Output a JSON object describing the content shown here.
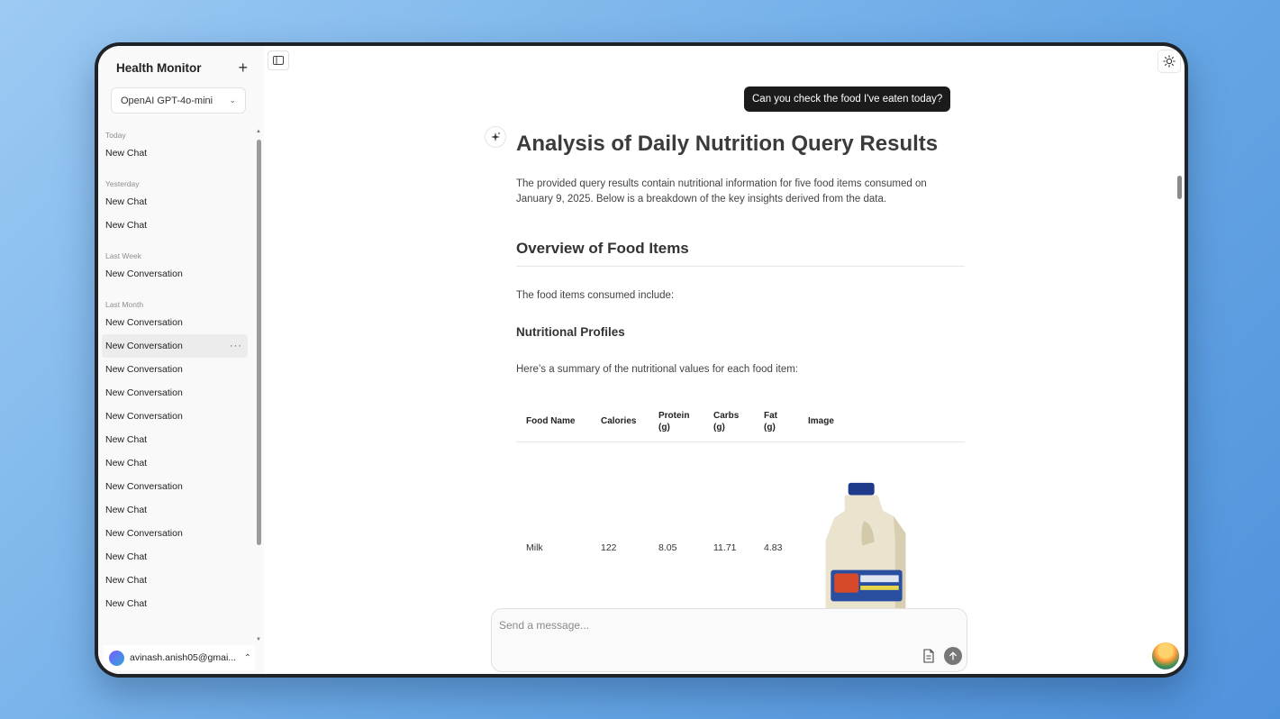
{
  "sidebar": {
    "title": "Health Monitor",
    "model": "OpenAI GPT-4o-mini",
    "groups": [
      {
        "label": "Today",
        "items": [
          "New Chat"
        ]
      },
      {
        "label": "Yesterday",
        "items": [
          "New Chat",
          "New Chat"
        ]
      },
      {
        "label": "Last Week",
        "items": [
          "New Conversation"
        ]
      },
      {
        "label": "Last Month",
        "items": [
          "New Conversation",
          "New Conversation",
          "New Conversation",
          "New Conversation",
          "New Conversation",
          "New Chat",
          "New Chat",
          "New Conversation",
          "New Chat",
          "New Conversation",
          "New Chat",
          "New Chat",
          "New Chat"
        ]
      }
    ],
    "user": "avinash.anish05@gmai..."
  },
  "chat": {
    "user_message": "Can you check the food I've eaten today?",
    "title": "Analysis of Daily Nutrition Query Results",
    "intro": "The provided query results contain nutritional information for five food items consumed on January 9, 2025. Below is a breakdown of the key insights derived from the data.",
    "section_title": "Overview of Food Items",
    "section_text": "The food items consumed include:",
    "subsection_title": "Nutritional Profiles",
    "subsection_text": "Here’s a summary of the nutritional values for each food item:",
    "table": {
      "headers": [
        "Food Name",
        "Calories",
        "Protein (g)",
        "Carbs (g)",
        "Fat (g)",
        "Image"
      ],
      "rows": [
        {
          "food": "Milk",
          "calories": "122",
          "protein": "8.05",
          "carbs": "11.71",
          "fat": "4.83"
        }
      ]
    }
  },
  "composer": {
    "placeholder": "Send a message..."
  },
  "icons": {
    "new_chat": "plus-icon",
    "sidebar_toggle": "sidebar-toggle-icon",
    "theme": "sun-icon",
    "assistant": "sparkle-icon",
    "attach": "file-icon",
    "send": "arrow-up-icon"
  }
}
